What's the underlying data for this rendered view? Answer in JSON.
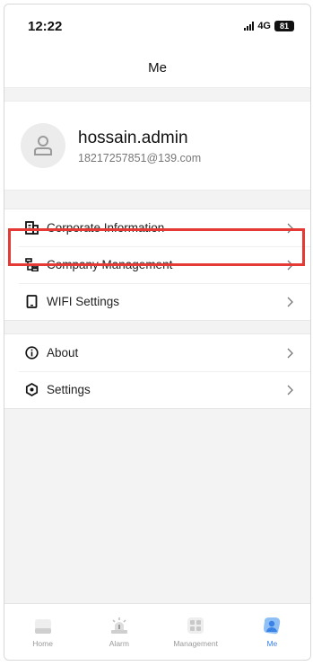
{
  "status_bar": {
    "time": "12:22",
    "network": "4G",
    "battery": "81"
  },
  "header": {
    "title": "Me"
  },
  "profile": {
    "username": "hossain.admin",
    "email": "18217257851@139.com"
  },
  "menu_group_1": [
    {
      "label": "Corporate Information",
      "icon": "building-icon"
    },
    {
      "label": "Company Management",
      "icon": "org-tree-icon"
    },
    {
      "label": "WIFI Settings",
      "icon": "phone-device-icon"
    }
  ],
  "menu_group_2": [
    {
      "label": "About",
      "icon": "info-icon"
    },
    {
      "label": "Settings",
      "icon": "settings-hexagon-icon"
    }
  ],
  "tabbar": [
    {
      "label": "Home",
      "icon": "home-icon"
    },
    {
      "label": "Alarm",
      "icon": "alarm-icon"
    },
    {
      "label": "Management",
      "icon": "management-grid-icon"
    },
    {
      "label": "Me",
      "icon": "me-profile-icon",
      "active": true
    }
  ],
  "colors": {
    "accent": "#3b82e6",
    "highlight_box": "#e53935",
    "background": "#f3f3f3"
  }
}
